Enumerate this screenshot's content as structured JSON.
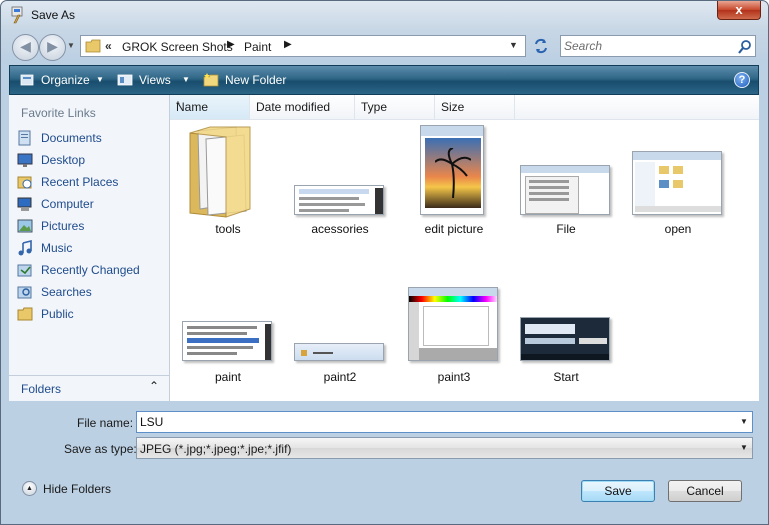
{
  "window": {
    "title": "Save As",
    "close_label": "x"
  },
  "address": {
    "overflow": "«",
    "crumbs": [
      "GROK Screen Shots",
      "Paint"
    ],
    "separator": "▶"
  },
  "search": {
    "placeholder": "Search"
  },
  "toolbar": {
    "organize": "Organize",
    "views": "Views",
    "new_folder": "New Folder",
    "help": "?"
  },
  "sidebar": {
    "title": "Favorite Links",
    "items": [
      {
        "label": "Documents",
        "icon": "documents-icon"
      },
      {
        "label": "Desktop",
        "icon": "desktop-icon"
      },
      {
        "label": "Recent Places",
        "icon": "recent-places-icon"
      },
      {
        "label": "Computer",
        "icon": "computer-icon"
      },
      {
        "label": "Pictures",
        "icon": "pictures-icon"
      },
      {
        "label": "Music",
        "icon": "music-icon"
      },
      {
        "label": "Recently Changed",
        "icon": "recently-changed-icon"
      },
      {
        "label": "Searches",
        "icon": "searches-icon"
      },
      {
        "label": "Public",
        "icon": "public-folder-icon"
      }
    ],
    "folders_label": "Folders"
  },
  "columns": [
    "Name",
    "Date modified",
    "Type",
    "Size"
  ],
  "files": [
    {
      "name": "tools",
      "kind": "folder"
    },
    {
      "name": "acessories",
      "kind": "image"
    },
    {
      "name": "edit picture",
      "kind": "image"
    },
    {
      "name": "File",
      "kind": "image"
    },
    {
      "name": "open",
      "kind": "image"
    },
    {
      "name": "paint",
      "kind": "image"
    },
    {
      "name": "paint2",
      "kind": "image"
    },
    {
      "name": "paint3",
      "kind": "image"
    },
    {
      "name": "Start",
      "kind": "image"
    }
  ],
  "form": {
    "file_name_label": "File name:",
    "file_name_value": "LSU",
    "save_type_label": "Save as type:",
    "save_type_value": "JPEG (*.jpg;*.jpeg;*.jpe;*.jfif)"
  },
  "footer": {
    "hide_folders": "Hide Folders",
    "save": "Save",
    "cancel": "Cancel"
  },
  "colors": {
    "toolbar": "#2f6686",
    "link": "#1f4b8c",
    "accent": "#3c7fb1"
  }
}
